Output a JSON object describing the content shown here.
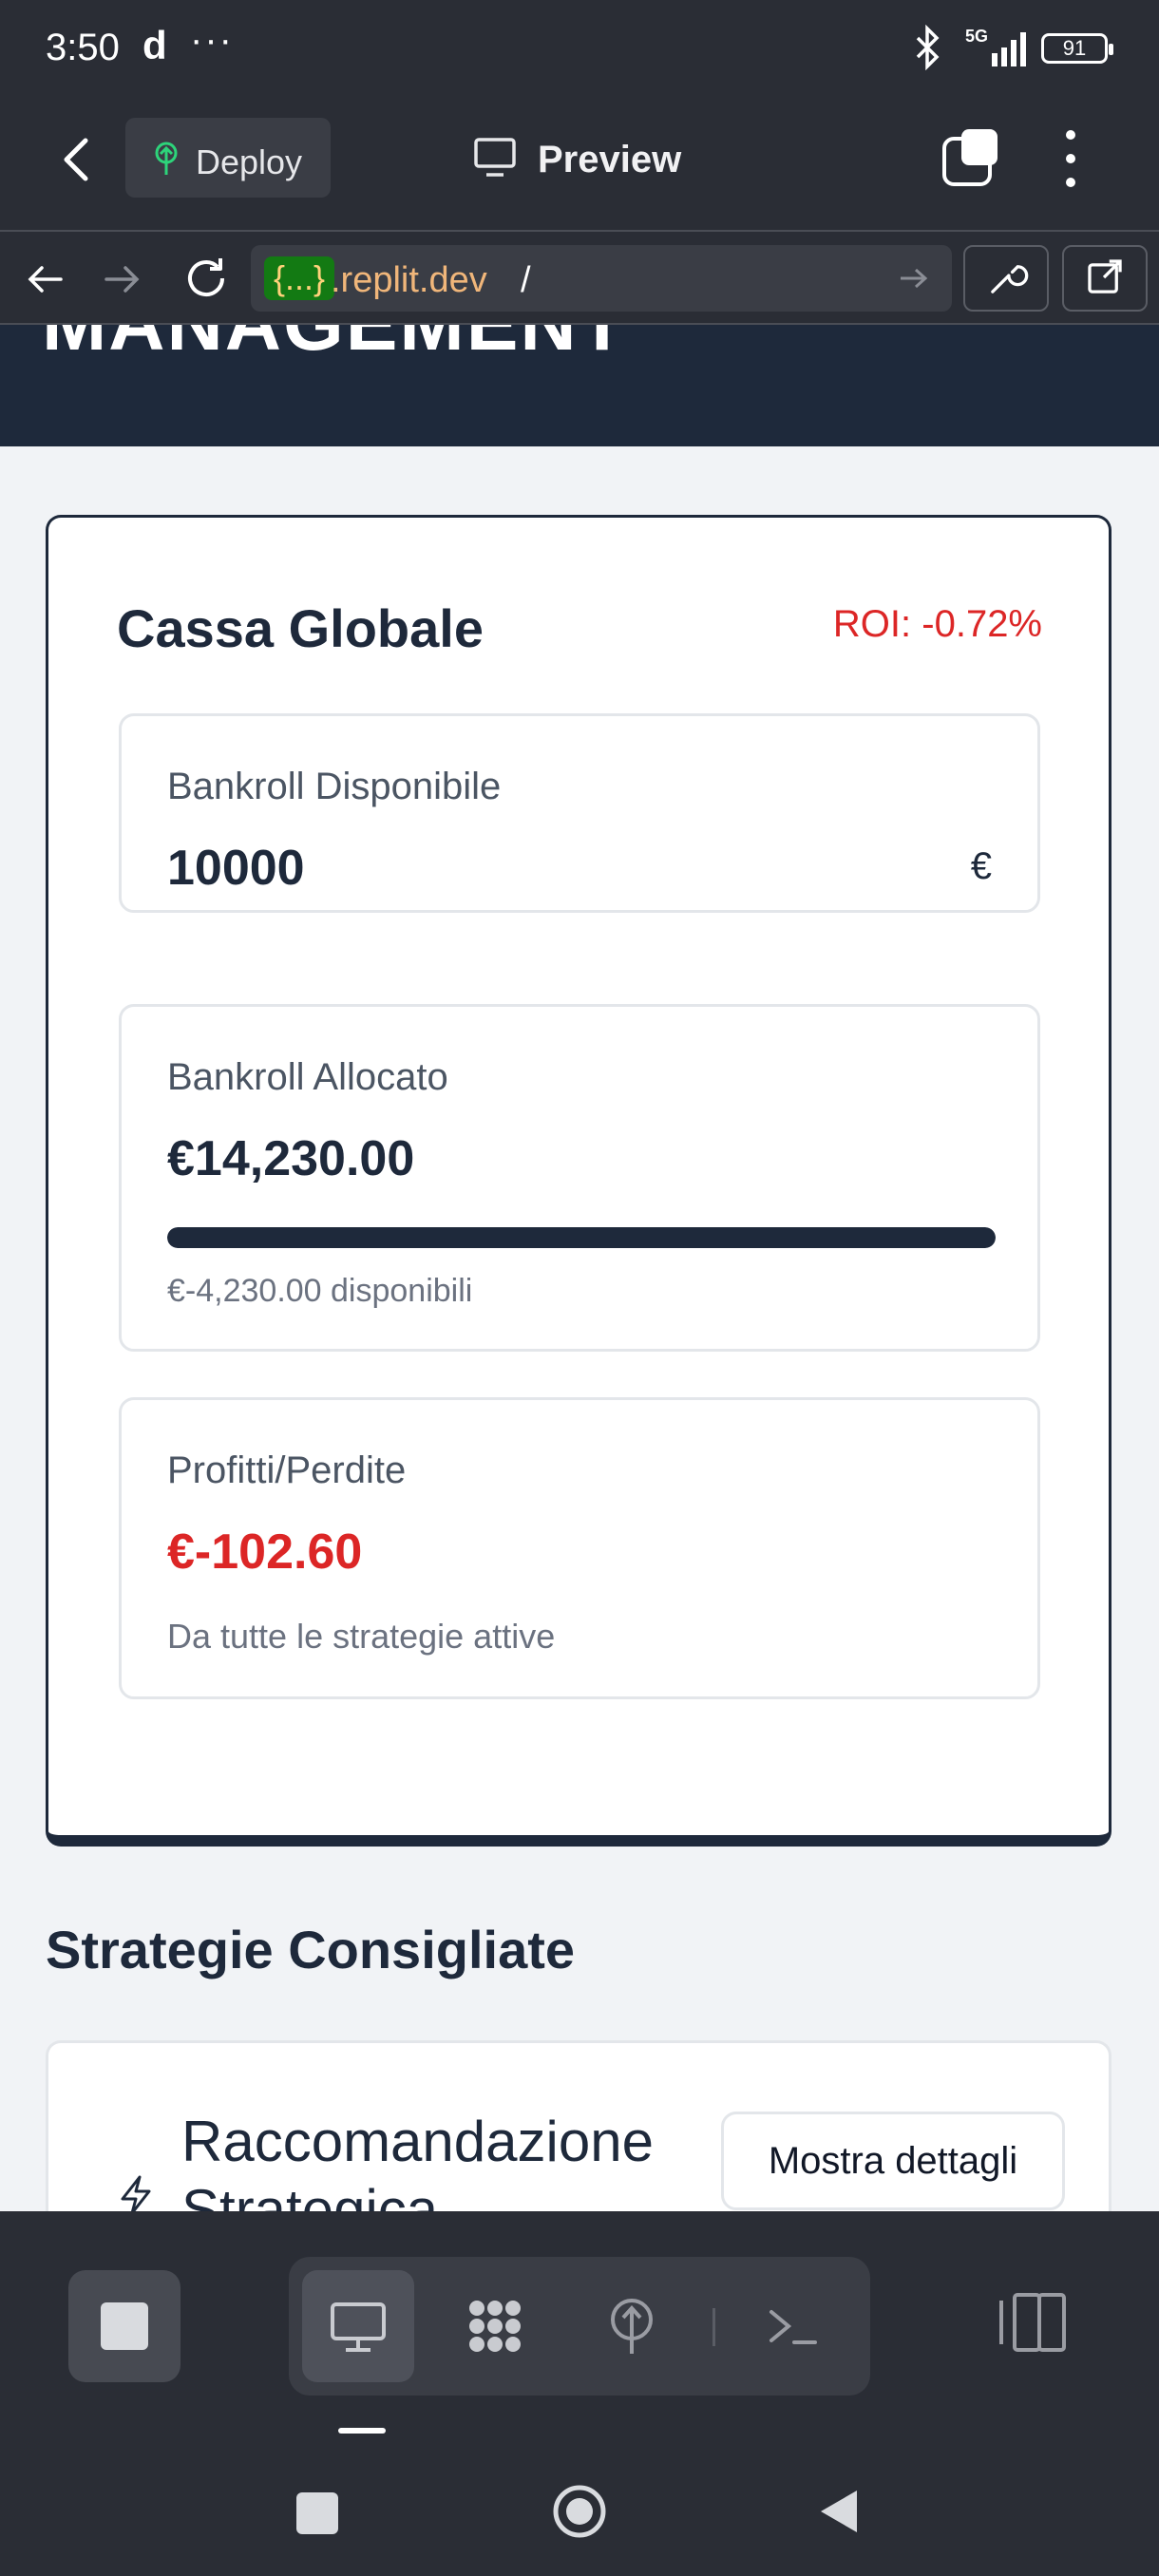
{
  "status_bar": {
    "time": "3:50",
    "app_indicator": "d",
    "more": "···",
    "network": "5G",
    "battery": "91"
  },
  "app_header": {
    "deploy_label": "Deploy",
    "preview_label": "Preview"
  },
  "browser": {
    "url_badge": "{...}",
    "url_domain": ".replit.dev",
    "url_path": "/"
  },
  "page": {
    "header_title": "MANAGEMENT",
    "cassa": {
      "title": "Cassa Globale",
      "roi": "ROI: -0.72%",
      "bankroll_disponibile": {
        "label": "Bankroll Disponibile",
        "value": "10000",
        "currency": "€"
      },
      "bankroll_allocato": {
        "label": "Bankroll Allocato",
        "value": "€14,230.00",
        "progress_fraction": 1.0,
        "note": "€-4,230.00 disponibili"
      },
      "profitti": {
        "label": "Profitti/Perdite",
        "value": "€-102.60",
        "note": "Da tutte le strategie attive"
      }
    },
    "strategie": {
      "title": "Strategie Consigliate",
      "rec_title": "Raccomandazione Strategica",
      "details_button": "Mostra dettagli"
    }
  },
  "colors": {
    "dark_navy": "#1e293b",
    "negative_red": "#dc2626",
    "chrome_dark": "#2a2d35",
    "url_badge_green": "#137a13",
    "url_domain_orange": "#f0b67a"
  },
  "icons": {
    "dock": [
      "stop-icon",
      "monitor-icon",
      "grid-icon",
      "globe-tree-icon",
      "terminal-icon",
      "panel-icon"
    ]
  }
}
